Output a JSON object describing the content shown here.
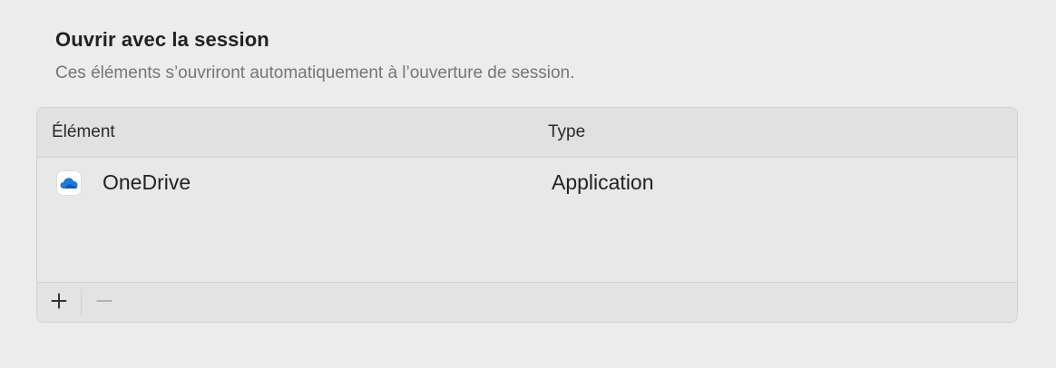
{
  "section": {
    "title": "Ouvrir avec la session",
    "subtitle": "Ces éléments s’ouvriront automatiquement à l’ouverture de session."
  },
  "table": {
    "columns": [
      "Élément",
      "Type"
    ],
    "rows": [
      {
        "name": "OneDrive",
        "type": "Application",
        "icon": "onedrive-cloud-icon"
      }
    ]
  },
  "toolbar": {
    "add_icon": "plus-icon",
    "remove_icon": "minus-icon"
  },
  "colors": {
    "onedrive_blue": "#1f7ad8",
    "background": "#ececec"
  }
}
